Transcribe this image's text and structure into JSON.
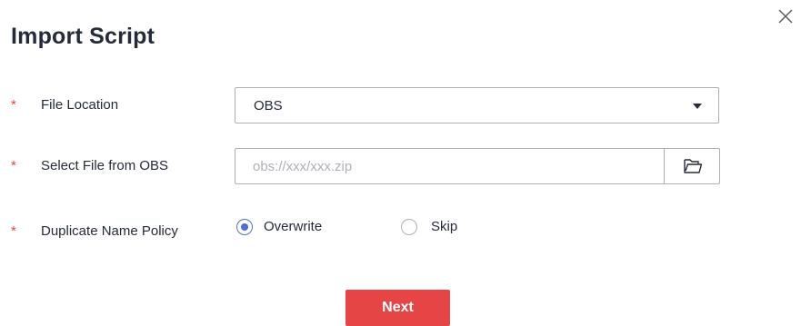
{
  "dialog": {
    "title": "Import Script",
    "close_icon": "close-icon"
  },
  "form": {
    "required_mark": "*",
    "file_location": {
      "label": "File Location",
      "value": "OBS",
      "icon": "chevron-down-icon"
    },
    "select_file": {
      "label": "Select File from OBS",
      "value": "",
      "placeholder": "obs://xxx/xxx.zip",
      "icon": "folder-icon"
    },
    "duplicate_policy": {
      "label": "Duplicate Name Policy",
      "options": [
        {
          "label": "Overwrite",
          "selected": true
        },
        {
          "label": "Skip",
          "selected": false
        }
      ]
    }
  },
  "footer": {
    "next_label": "Next"
  },
  "colors": {
    "primary": "#e54545",
    "radio_checked": "#526ecc",
    "border": "#adb0b8",
    "text": "#252b3a",
    "required": "#e54545"
  }
}
